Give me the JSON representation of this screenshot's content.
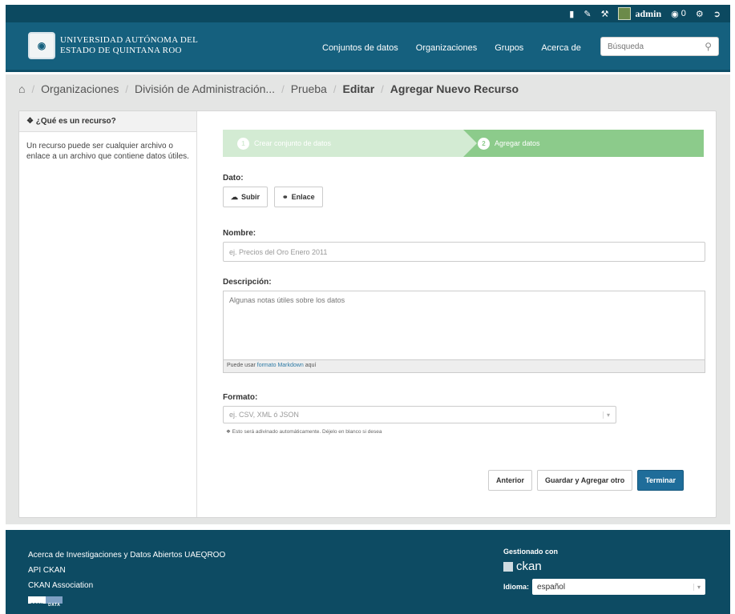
{
  "topbar": {
    "icons": [
      "document-icon",
      "pencil-icon",
      "wrench-icon",
      "dashboard-icon",
      "settings-icon",
      "logout-icon"
    ],
    "username": "admin",
    "notifications": "0"
  },
  "masthead": {
    "logo_line1": "Universidad Autónoma del",
    "logo_line2": "Estado de Quintana Roo",
    "nav": [
      "Conjuntos de datos",
      "Organizaciones",
      "Grupos",
      "Acerca de"
    ],
    "search_placeholder": "Búsqueda"
  },
  "breadcrumb": {
    "items": [
      "Organizaciones",
      "División de Administración...",
      "Prueba",
      "Editar",
      "Agregar Nuevo Recurso"
    ]
  },
  "aside": {
    "title": "¿Qué es un recurso?",
    "text": "Un recurso puede ser cualquier archivo o enlace a un archivo que contiene datos útiles."
  },
  "stages": [
    {
      "num": "1",
      "label": "Crear conjunto de datos"
    },
    {
      "num": "2",
      "label": "Agregar datos"
    }
  ],
  "form": {
    "dato_label": "Dato:",
    "upload_label": "Subir",
    "link_label": "Enlace",
    "name_label": "Nombre:",
    "name_placeholder": "ej. Precios del Oro Enero 2011",
    "desc_label": "Descripción:",
    "desc_placeholder": "Algunas notas útiles sobre los datos",
    "md_help_prefix": "Puede usar",
    "md_help_link": "formato Markdown",
    "md_help_suffix": "aquí",
    "format_label": "Formato:",
    "format_placeholder": "ej. CSV, XML ó JSON",
    "format_hint": "Esto será adivinado automáticamente. Déjelo en blanco si desea"
  },
  "actions": {
    "previous": "Anterior",
    "save_add": "Guardar y Agregar otro",
    "finish": "Terminar"
  },
  "footer": {
    "links": [
      "Acerca de Investigaciones y Datos Abiertos UAEQROO",
      "API CKAN",
      "CKAN Association"
    ],
    "open_data_a": "OPEN",
    "open_data_b": "DATA",
    "managed_by": "Gestionado con",
    "ckan": "ckan",
    "language_label": "Idioma:",
    "language_value": "español"
  },
  "colors": {
    "masthead": "#15607e",
    "stage_active": "#8ccb8b",
    "primary_button": "#1f6d9a"
  }
}
